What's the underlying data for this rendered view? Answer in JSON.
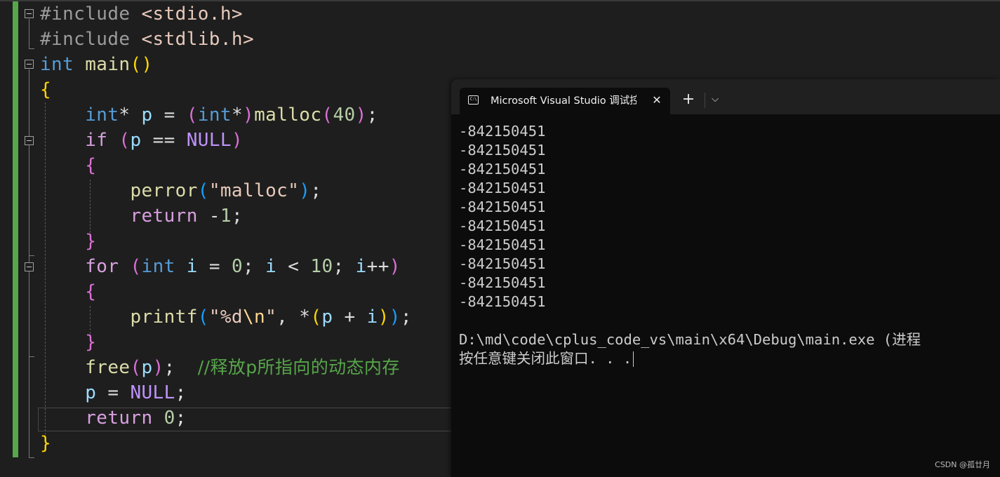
{
  "editor": {
    "lines": [
      [
        [
          "t-pp",
          "#include "
        ],
        [
          "t-str",
          "<stdio.h>"
        ]
      ],
      [
        [
          "t-pp",
          "#include "
        ],
        [
          "t-str",
          "<stdlib.h>"
        ]
      ],
      [
        [
          "t-kw",
          "int"
        ],
        [
          "t-op",
          " "
        ],
        [
          "t-fn",
          "main"
        ],
        [
          "t-br1",
          "()"
        ]
      ],
      [
        [
          "t-br1",
          "{"
        ]
      ],
      [
        [
          "t-op",
          "    "
        ],
        [
          "t-kw",
          "int"
        ],
        [
          "t-op",
          "* "
        ],
        [
          "t-var",
          "p"
        ],
        [
          "t-op",
          " = "
        ],
        [
          "t-br2",
          "("
        ],
        [
          "t-kw",
          "int"
        ],
        [
          "t-op",
          "*"
        ],
        [
          "t-br2",
          ")"
        ],
        [
          "t-fn",
          "malloc"
        ],
        [
          "t-br2",
          "("
        ],
        [
          "t-num",
          "40"
        ],
        [
          "t-br2",
          ")"
        ],
        [
          "t-op",
          ";"
        ]
      ],
      [
        [
          "t-op",
          "    "
        ],
        [
          "t-ctl",
          "if"
        ],
        [
          "t-op",
          " "
        ],
        [
          "t-br2",
          "("
        ],
        [
          "t-var",
          "p"
        ],
        [
          "t-op",
          " == "
        ],
        [
          "t-mac",
          "NULL"
        ],
        [
          "t-br2",
          ")"
        ]
      ],
      [
        [
          "t-op",
          "    "
        ],
        [
          "t-br2",
          "{"
        ]
      ],
      [
        [
          "t-op",
          "        "
        ],
        [
          "t-fn",
          "perror"
        ],
        [
          "t-br3",
          "("
        ],
        [
          "t-str",
          "\"malloc\""
        ],
        [
          "t-br3",
          ")"
        ],
        [
          "t-op",
          ";"
        ]
      ],
      [
        [
          "t-op",
          "        "
        ],
        [
          "t-ctl",
          "return"
        ],
        [
          "t-op",
          " -"
        ],
        [
          "t-num",
          "1"
        ],
        [
          "t-op",
          ";"
        ]
      ],
      [
        [
          "t-op",
          "    "
        ],
        [
          "t-br2",
          "}"
        ]
      ],
      [
        [
          "t-op",
          "    "
        ],
        [
          "t-ctl",
          "for"
        ],
        [
          "t-op",
          " "
        ],
        [
          "t-br2",
          "("
        ],
        [
          "t-kw",
          "int"
        ],
        [
          "t-op",
          " "
        ],
        [
          "t-var",
          "i"
        ],
        [
          "t-op",
          " = "
        ],
        [
          "t-num",
          "0"
        ],
        [
          "t-op",
          "; "
        ],
        [
          "t-var",
          "i"
        ],
        [
          "t-op",
          " < "
        ],
        [
          "t-num",
          "10"
        ],
        [
          "t-op",
          "; "
        ],
        [
          "t-var",
          "i"
        ],
        [
          "t-op",
          "++"
        ],
        [
          "t-br2",
          ")"
        ]
      ],
      [
        [
          "t-op",
          "    "
        ],
        [
          "t-br2",
          "{"
        ]
      ],
      [
        [
          "t-op",
          "        "
        ],
        [
          "t-fn",
          "printf"
        ],
        [
          "t-br3",
          "("
        ],
        [
          "t-str",
          "\"%d"
        ],
        [
          "t-esc",
          "\\n"
        ],
        [
          "t-str",
          "\""
        ],
        [
          "t-op",
          ", *"
        ],
        [
          "t-br1",
          "("
        ],
        [
          "t-var",
          "p"
        ],
        [
          "t-op",
          " + "
        ],
        [
          "t-var",
          "i"
        ],
        [
          "t-br1",
          ")"
        ],
        [
          "t-br3",
          ")"
        ],
        [
          "t-op",
          ";"
        ]
      ],
      [
        [
          "t-op",
          "    "
        ],
        [
          "t-br2",
          "}"
        ]
      ],
      [
        [
          "t-op",
          "    "
        ],
        [
          "t-fn",
          "free"
        ],
        [
          "t-br2",
          "("
        ],
        [
          "t-var",
          "p"
        ],
        [
          "t-br2",
          ")"
        ],
        [
          "t-op",
          ";  "
        ],
        [
          "t-cmt",
          "//释放p所指向的动态内存"
        ]
      ],
      [
        [
          "t-op",
          "    "
        ],
        [
          "t-var",
          "p"
        ],
        [
          "t-op",
          " = "
        ],
        [
          "t-mac",
          "NULL"
        ],
        [
          "t-op",
          ";"
        ]
      ],
      [
        [
          "t-op",
          "    "
        ],
        [
          "t-ctl",
          "return"
        ],
        [
          "t-op",
          " "
        ],
        [
          "t-num",
          "0"
        ],
        [
          "t-op",
          ";"
        ]
      ],
      [
        [
          "t-br1",
          "}"
        ]
      ]
    ]
  },
  "terminal": {
    "tab_icon": "C:\\",
    "tab_title": "Microsoft Visual Studio 调试控制台",
    "close_glyph": "✕",
    "new_tab_glyph": "+",
    "dropdown_glyph": "⌵",
    "output": [
      "-842150451",
      "-842150451",
      "-842150451",
      "-842150451",
      "-842150451",
      "-842150451",
      "-842150451",
      "-842150451",
      "-842150451",
      "-842150451",
      "",
      "D:\\md\\code\\cplus_code_vs\\main\\x64\\Debug\\main.exe (进程",
      "按任意键关闭此窗口. . ."
    ]
  },
  "watermark": "CSDN @孤廿月",
  "colors": {
    "editor_bg": "#1e1e1e",
    "change_bar": "#57a64a",
    "keyword": "#569cd6",
    "control": "#d8a0df",
    "string": "#e8c9bb",
    "function": "#dcdcaa",
    "variable": "#9cdcfe",
    "number": "#b5cea8",
    "comment": "#57a64a",
    "terminal_bg": "#0c0c0c"
  }
}
